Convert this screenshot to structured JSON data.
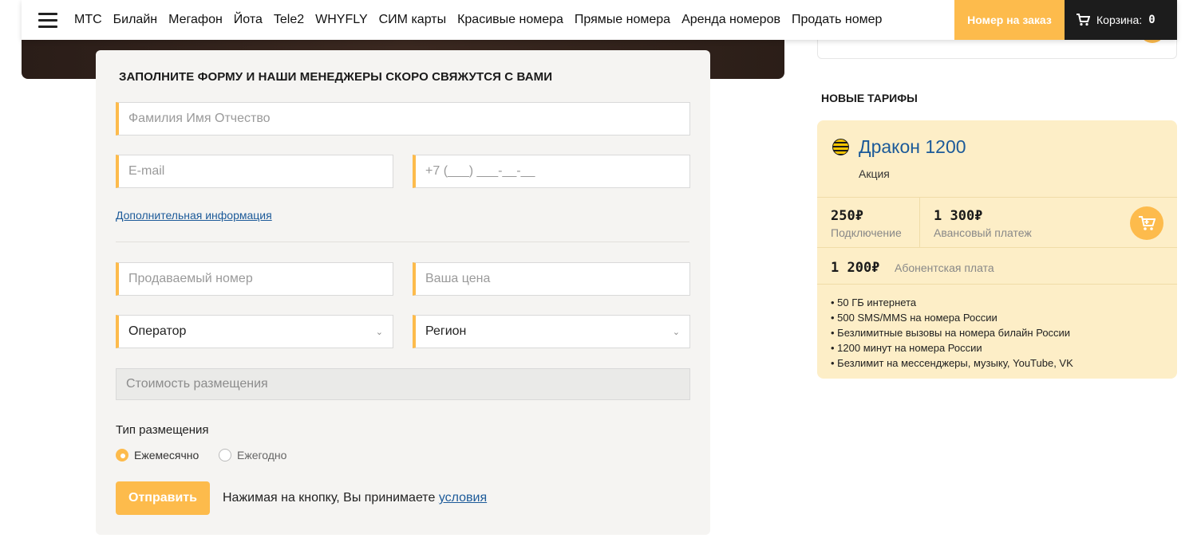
{
  "nav": {
    "items": [
      "МТС",
      "Билайн",
      "Мегафон",
      "Йота",
      "Tele2",
      "WHYFLY",
      "СИМ карты",
      "Красивые номера",
      "Прямые номера",
      "Аренда номеров",
      "Продать номер"
    ],
    "order_button": "Номер на заказ",
    "cart_label": "Корзина:",
    "cart_count": "0"
  },
  "form": {
    "title": "ЗАПОЛНИТЕ ФОРМУ И НАШИ МЕНЕДЖЕРЫ СКОРО СВЯЖУТСЯ С ВАМИ",
    "fio_placeholder": "Фамилия Имя Отчество",
    "email_placeholder": "E-mail",
    "phone_placeholder": "+7 (___) ___-__-__",
    "more_info_link": "Дополнительная информация",
    "number_placeholder": "Продаваемый номер",
    "price_placeholder": "Ваша цена",
    "operator_select": "Оператор",
    "region_select": "Регион",
    "cost_placeholder": "Стоимость размещения",
    "placement_type_label": "Тип размещения",
    "option_monthly": "Ежемесячно",
    "option_yearly": "Ежегодно",
    "selected_option": "monthly",
    "submit_label": "Отправить",
    "agree_text": "Нажимая на кнопку, Вы принимаете",
    "agree_link": "условия"
  },
  "sidebar": {
    "section_title": "НОВЫЕ ТАРИФЫ",
    "tariff": {
      "name": "Дракон 1200",
      "promo": "Акция",
      "connect_price": "250₽",
      "connect_label": "Подключение",
      "advance_price": "1 300₽",
      "advance_label": "Авансовый платеж",
      "monthly_price": "1 200₽",
      "monthly_label": "Абонентская плата",
      "features": [
        "• 50 ГБ интернета",
        "• 500 SMS/MMS на номера России",
        "• Безлимитные вызовы на номера билайн России",
        "• 1200 минут на номера России",
        "• Безлимит на мессенджеры, музыку, YouTube, VK"
      ]
    }
  },
  "colors": {
    "accent": "#fdbb4c",
    "link": "#1c5a99",
    "tariff_bg": "#fdeec7"
  }
}
